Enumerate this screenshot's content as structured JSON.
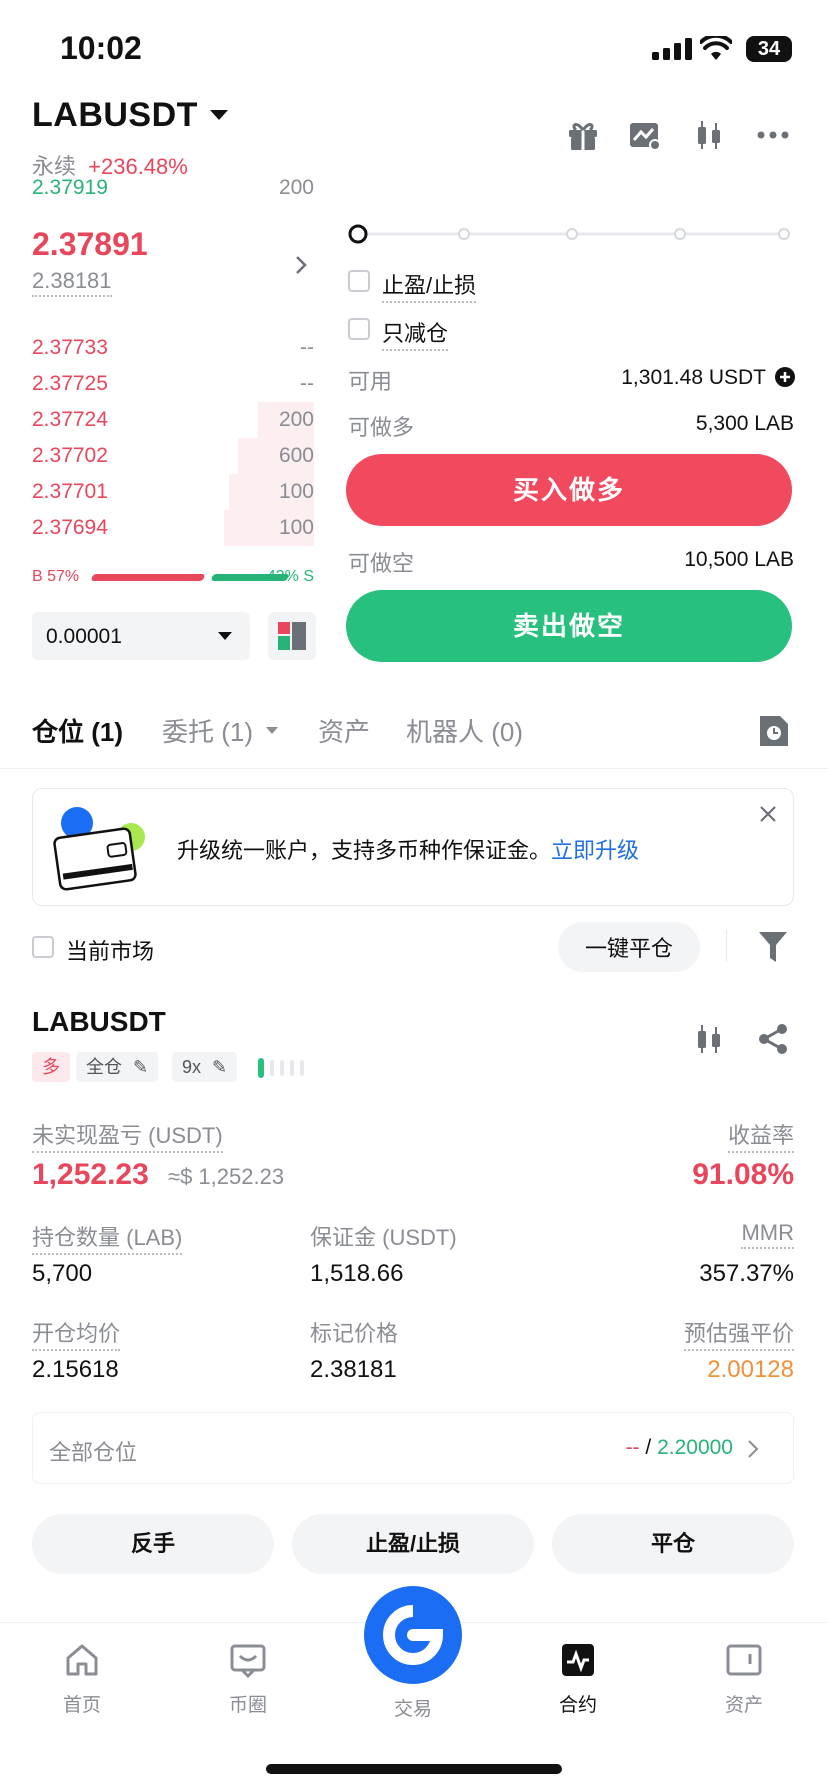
{
  "status_bar": {
    "time": "10:02",
    "battery": "34"
  },
  "header": {
    "pair": "LABUSDT",
    "type": "永续",
    "change": "+236.48%"
  },
  "order_book": {
    "top_bid_price": "2.37919",
    "top_bid_qty": "200",
    "last_price": "2.37891",
    "mark_price": "2.38181",
    "asks": [
      {
        "price": "2.37733",
        "qty": "--",
        "depth": 0
      },
      {
        "price": "2.37725",
        "qty": "--",
        "depth": 0
      },
      {
        "price": "2.37724",
        "qty": "200",
        "depth": 0.2
      },
      {
        "price": "2.37702",
        "qty": "600",
        "depth": 0.27
      },
      {
        "price": "2.37701",
        "qty": "100",
        "depth": 0.3
      },
      {
        "price": "2.37694",
        "qty": "100",
        "depth": 0.32
      }
    ],
    "buy_ratio": "B 57%",
    "sell_ratio": "43% S",
    "buy_pct": 57,
    "precision": "0.00001"
  },
  "form": {
    "tp_sl": "止盈/止损",
    "reduce_only": "只减仓",
    "available_label": "可用",
    "available_value": "1,301.48 USDT",
    "long_label": "可做多",
    "long_value": "5,300 LAB",
    "buy_button": "买入做多",
    "short_label": "可做空",
    "short_value": "10,500 LAB",
    "sell_button": "卖出做空"
  },
  "tabs": [
    "仓位 (1)",
    "委托 (1)",
    "资产",
    "机器人 (0)"
  ],
  "banner": {
    "text": "升级统一账户，支持多币种作保证金。",
    "link": "立即升级"
  },
  "filter": {
    "current_market": "当前市场",
    "close_all": "一键平仓"
  },
  "position": {
    "symbol": "LABUSDT",
    "side": "多",
    "margin_mode": "全仓",
    "leverage": "9x",
    "upnl_label": "未实现盈亏 (USDT)",
    "upnl_value": "1,252.23",
    "upnl_usd": "≈$ 1,252.23",
    "roe_label": "收益率",
    "roe_value": "91.08%",
    "size_label": "持仓数量 (LAB)",
    "size_value": "5,700",
    "margin_label": "保证金 (USDT)",
    "margin_value": "1,518.66",
    "mmr_label": "MMR",
    "mmr_value": "357.37%",
    "entry_label": "开仓均价",
    "entry_value": "2.15618",
    "mark_label": "标记价格",
    "mark_value": "2.38181",
    "liq_label": "预估强平价",
    "liq_value": "2.00128",
    "all_positions_label": "全部仓位",
    "tp_value": "--",
    "sl_value": "2.20000"
  },
  "actions": {
    "reverse": "反手",
    "tpsl": "止盈/止损",
    "close": "平仓"
  },
  "nav": {
    "home": "首页",
    "circle": "币圈",
    "trade": "交易",
    "futures": "合约",
    "assets": "资产"
  },
  "colors": {
    "red": "#e8465b",
    "green": "#27b378",
    "blue": "#1b6ef3",
    "orange": "#f0913a"
  }
}
